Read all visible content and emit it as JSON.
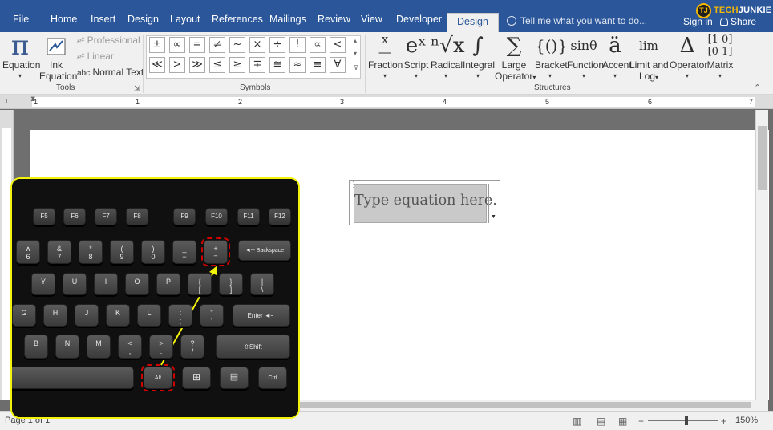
{
  "tabs": [
    "File",
    "Home",
    "Insert",
    "Design",
    "Layout",
    "References",
    "Mailings",
    "Review",
    "View",
    "Developer",
    "Design"
  ],
  "active_tab_index": 10,
  "tell_me": "Tell me what you want to do...",
  "sign_in": "Sign in",
  "share": "Share",
  "logo": {
    "initials": "TJ",
    "word1": "TECH",
    "word2": "JUNKIE"
  },
  "tools": {
    "equation": "Equation",
    "ink_equation_1": "Ink",
    "ink_equation_2": "Equation",
    "professional": "Professional",
    "linear": "Linear",
    "normal_text": "Normal Text",
    "abc": "abc",
    "group_label": "Tools"
  },
  "symbols": {
    "row1": [
      "±",
      "∞",
      "=",
      "≠",
      "~",
      "×",
      "÷",
      "!",
      "∝",
      "<"
    ],
    "row2": [
      "≪",
      ">",
      "≫",
      "≤",
      "≥",
      "∓",
      "≅",
      "≈",
      "≡",
      "∀"
    ],
    "group_label": "Symbols"
  },
  "structures": {
    "items": [
      {
        "label": "Fraction",
        "glyph": "x/y",
        "line2": ""
      },
      {
        "label": "Script",
        "glyph": "eˣ",
        "line2": ""
      },
      {
        "label": "Radical",
        "glyph": "ⁿ√x",
        "line2": ""
      },
      {
        "label": "Integral",
        "glyph": "∫",
        "line2": ""
      },
      {
        "label": "Large",
        "glyph": "∑",
        "line2": "Operator"
      },
      {
        "label": "Bracket",
        "glyph": "{()}",
        "line2": ""
      },
      {
        "label": "Function",
        "glyph": "sinθ",
        "line2": ""
      },
      {
        "label": "Accent",
        "glyph": "ä",
        "line2": ""
      },
      {
        "label": "Limit and",
        "glyph": "lim",
        "line2": "Log"
      },
      {
        "label": "Operator",
        "glyph": "Δ",
        "line2": ""
      },
      {
        "label": "Matrix",
        "glyph": "[10;01]",
        "line2": ""
      }
    ],
    "group_label": "Structures"
  },
  "ruler_numbers": [
    "1",
    "1",
    "2",
    "3",
    "4",
    "5",
    "6",
    "7"
  ],
  "equation_placeholder": "Type equation here.",
  "status": {
    "page": "Page 1 of 1",
    "zoom": "150%",
    "minus": "−",
    "plus": "+"
  },
  "keyboard": {
    "fkeys": [
      "F5",
      "F6",
      "F7",
      "F8",
      "F9",
      "F10",
      "F11",
      "F12"
    ],
    "num_row": [
      [
        "∧",
        "6"
      ],
      [
        "&",
        "7"
      ],
      [
        "*",
        "8"
      ],
      [
        "(",
        "9"
      ],
      [
        ")",
        "0"
      ],
      [
        "_",
        "−"
      ],
      [
        "+",
        "="
      ]
    ],
    "backspace": "◄─ Backspace",
    "row_y": [
      "Y",
      "U",
      "I",
      "O",
      "P",
      "{ [",
      "} ]",
      "| \\"
    ],
    "row_g": [
      "G",
      "H",
      "J",
      "K",
      "L",
      ": ;",
      "\" '"
    ],
    "enter": "Enter ◄┘",
    "row_b": [
      "B",
      "N",
      "M",
      "< ,",
      "> .",
      "? /"
    ],
    "shift": "⇧Shift",
    "alt": "Alt",
    "ctrl": "Ctrl"
  },
  "colors": {
    "ribbon_blue": "#2b579a",
    "highlight_yellow": "#f2f20a",
    "highlight_red": "#d30000"
  }
}
